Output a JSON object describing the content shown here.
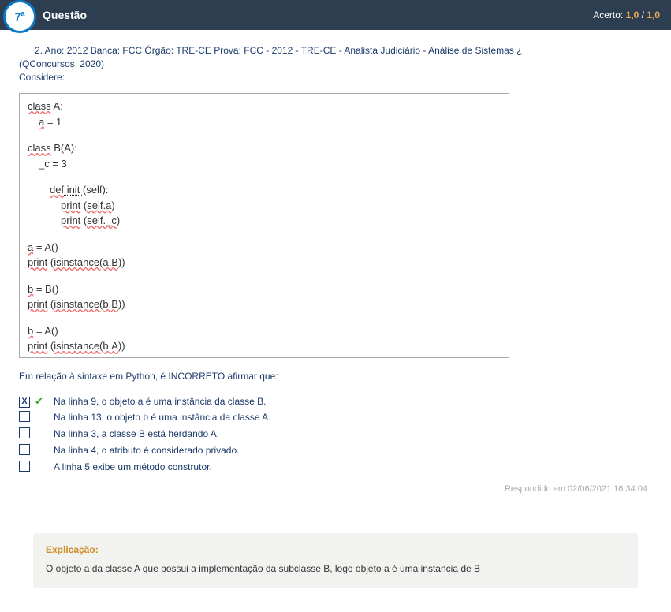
{
  "header": {
    "number": "7",
    "ordinal_sup": "a",
    "title": "Questão",
    "score_label": "Acerto:",
    "score_earned": "1,0",
    "score_sep": " / ",
    "score_total": "1,0"
  },
  "prompt": {
    "line1": "2. Ano: 2012 Banca: FCC Órgão: TRE-CE Prova: FCC - 2012 - TRE-CE - Analista Judiciário - Análise de Sistemas ¿",
    "line2": "(QConcursos, 2020)",
    "line3": "Considere:"
  },
  "code": {
    "l1a": "class",
    "l1b": " A:",
    "l2a": "a",
    "l2b": " = 1",
    "l3a": "class",
    "l3b": " B(A):",
    "l4a": "_c",
    "l4b": " = 3",
    "l5a": "def",
    "l5b": "   init   ",
    "l5c": "(self):",
    "l6a": "print",
    "l6b": " (",
    "l6c": "self.a",
    "l6d": ")",
    "l7a": "print",
    "l7b": " (",
    "l7c": "self._c",
    "l7d": ")",
    "l8a": "a",
    "l8b": " = A()",
    "l9a": "print",
    "l9b": " (",
    "l9c": "isinstance(a,B",
    "l9d": "))",
    "l10a": "b",
    "l10b": " = B()",
    "l11a": "print",
    "l11b": " (",
    "l11c": "isinstance(b,B",
    "l11d": "))",
    "l12a": "b",
    "l12b": " = A()",
    "l13a": "print",
    "l13b": " (",
    "l13c": "isinstance(b,A",
    "l13d": "))"
  },
  "question_text": "Em relação à sintaxe em Python, é INCORRETO afirmar que:",
  "options": [
    {
      "checked": true,
      "correct": true,
      "text": "Na linha 9, o objeto a é uma instância da classe B."
    },
    {
      "checked": false,
      "correct": false,
      "text": "Na linha 13, o objeto b é uma instância da classe A."
    },
    {
      "checked": false,
      "correct": false,
      "text": "Na linha 3, a classe B está herdando A."
    },
    {
      "checked": false,
      "correct": false,
      "text": "Na linha 4, o atributo é considerado privado."
    },
    {
      "checked": false,
      "correct": false,
      "text": "A linha 5 exibe um método construtor."
    }
  ],
  "answered_ts": "Respondido em 02/06/2021 16:34:04",
  "explanation": {
    "title": "Explicação:",
    "body": "O objeto a da classe A que possui a implementação da subclasse B, logo objeto a é uma instancia de B"
  },
  "glyphs": {
    "x": "X",
    "check": "✔"
  }
}
